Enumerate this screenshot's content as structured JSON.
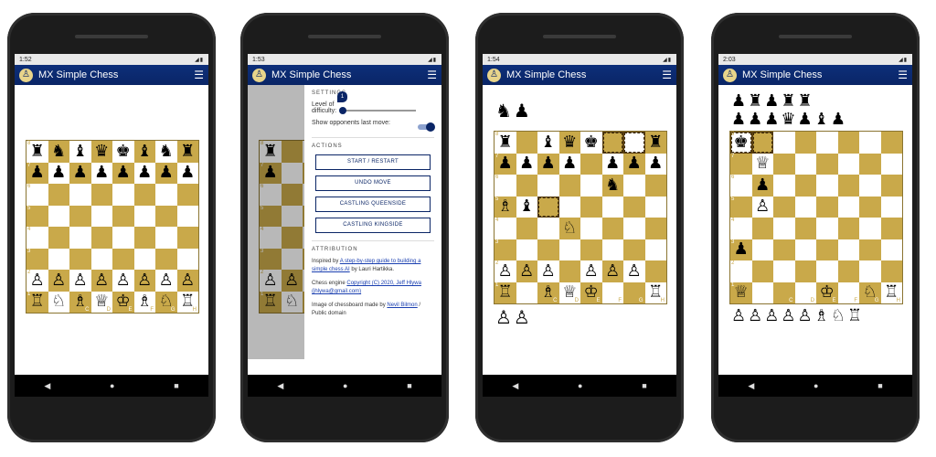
{
  "app": {
    "title": "MX Simple Chess",
    "icon": "chess-icon",
    "brand_color": "#0a2566"
  },
  "phones": [
    {
      "time": "1:52",
      "status_icons": "◢▮"
    },
    {
      "time": "1:53",
      "status_icons": "◢▮"
    },
    {
      "time": "1:54",
      "status_icons": "◢▮"
    },
    {
      "time": "2:03",
      "status_icons": "◢▮"
    }
  ],
  "board_colors": {
    "dark": "#c9a94a",
    "light": "#ffffff"
  },
  "boards": {
    "initial": [
      "♜♞♝♛♚♝♞♜",
      "♟♟♟♟♟♟♟♟",
      "        ",
      "        ",
      "        ",
      "        ",
      "♙♙♙♙♙♙♙♙",
      "♖♘♗♕♔♗♘♖"
    ],
    "drawer_bg": [
      "♜       ",
      "♟       ",
      "        ",
      "        ",
      "        ",
      "        ",
      "♙♙      ",
      "♖♘      "
    ],
    "midgame": [
      "♜ ♝♛♚  ♜",
      "♟♟♟♟ ♟♟♟",
      "     ♞  ",
      "♗♝      ",
      "   ♘    ",
      "        ",
      "♙♙♙ ♙♙♙ ",
      "♖ ♗♕♔  ♖"
    ],
    "endgame": [
      "♚       ",
      " ♕      ",
      " ♟      ",
      " ♙      ",
      "        ",
      "♟       ",
      "        ",
      "♕   ♔ ♘♖"
    ]
  },
  "highlights": {
    "midgame": [
      "0-5",
      "0-6",
      "3-2"
    ],
    "endgame": [
      "0-0",
      "0-1"
    ]
  },
  "captured": {
    "midgame_top": "♞♟",
    "midgame_bottom": "♙♙",
    "endgame_top": "♟♜♟♜♜\n♟♟♟♛♟♝♟",
    "endgame_bottom": "♙♙♙♙♙♗♘♖"
  },
  "drawer": {
    "settings_title": "SETTINGS",
    "difficulty_label": "Level of difficulty:",
    "difficulty_value": "1",
    "difficulty_fraction": 0.0,
    "show_last_move_label": "Show opponents last move:",
    "show_last_move_on": true,
    "actions_title": "ACTIONS",
    "buttons": [
      "START / RESTART",
      "UNDO MOVE",
      "CASTLING QUEENSIDE",
      "CASTLING KINGSIDE"
    ],
    "attribution_title": "ATTRIBUTION",
    "attr1_prefix": "Inspired by ",
    "attr1_link": "A step-by-step guide to building a simple chess AI",
    "attr1_suffix": " by Lauri Hartikka.",
    "attr2_prefix": "Chess engine ",
    "attr2_link": "Copyright (C) 2020, Jeff Hlywa (jhlywa@gmail.com)",
    "attr3_prefix": "Image of chessboard made by ",
    "attr3_link": "Nevil Bilmon",
    "attr3_suffix": " / Public domain"
  },
  "navbar": {
    "back": "◀",
    "home": "●",
    "recent": "■"
  }
}
